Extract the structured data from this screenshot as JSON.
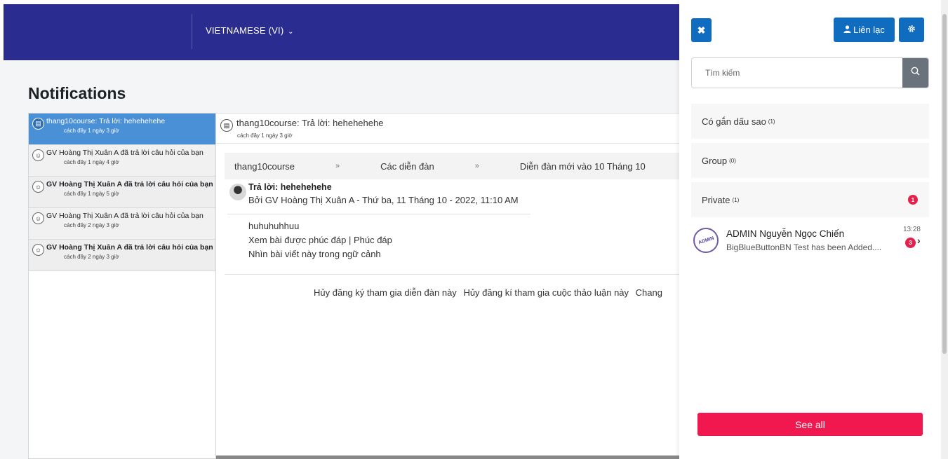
{
  "navbar": {
    "language": "VIETNAMESE (VI)",
    "language_chevron": "⌄"
  },
  "page": {
    "title": "Notifications"
  },
  "notifications": [
    {
      "title": "thang10course: Trả lời: hehehehehe",
      "time": "cách đây 1 ngày 3 giờ",
      "icon": "forum-icon",
      "state": "selected"
    },
    {
      "title": "GV Hoàng Thị Xuân A đã trả lời câu hỏi của bạn",
      "time": "cách đây 1 ngày 4 giờ",
      "icon": "user-icon",
      "state": "read"
    },
    {
      "title": "GV Hoàng Thị Xuân A đã trả lời câu hỏi của bạn",
      "time": "cách đây 1 ngày 5 giờ",
      "icon": "user-icon",
      "state": "unread"
    },
    {
      "title": "GV Hoàng Thị Xuân A đã trả lời câu hỏi của bạn",
      "time": "cách đây 2 ngày 3 giờ",
      "icon": "user-icon",
      "state": "read"
    },
    {
      "title": "GV Hoàng Thị Xuân A đã trả lời câu hỏi của bạn",
      "time": "cách đây 2 ngày 3 giờ",
      "icon": "user-icon",
      "state": "unread"
    }
  ],
  "detail": {
    "title": "thang10course: Trả lời: hehehehehe",
    "time": "cách đây 1 ngày 3 giờ",
    "breadcrumb": [
      "thang10course",
      "Các diễn đàn",
      "Diễn đàn mới vào 10 Tháng 10"
    ],
    "breadcrumb_sep": "»",
    "post_title": "Trả lời: hehehehehe",
    "post_by": "Bởi GV Hoàng Thị Xuân A - Thứ ba, 11 Tháng 10 - 2022, 11:10 AM",
    "post_body": "huhuhuhhuu",
    "post_links_1": "Xem bài được phúc đáp | Phúc đáp",
    "post_links_2": "Nhìn bài viết này trong ngữ cảnh",
    "footer_links": [
      "Hủy đăng ký tham gia diễn đàn này",
      "Hủy đăng kí tham gia cuộc thảo luận này",
      "Chang"
    ]
  },
  "drawer": {
    "close_label": "✖",
    "contact_label": "Liên lạc",
    "search_placeholder": "Tìm kiếm",
    "sections": [
      {
        "label": "Có gắn dấu sao",
        "count": "(1)",
        "badge": ""
      },
      {
        "label": "Group",
        "count": "(0)",
        "badge": ""
      },
      {
        "label": "Private",
        "count": "(1)",
        "badge": "1"
      }
    ],
    "conversation": {
      "name": "ADMIN Nguyễn Ngọc Chiến",
      "message": "BigBlueButtonBN Test has been Added....",
      "time": "13:28",
      "unread": "3",
      "avatar_text": "ADMIN"
    },
    "see_all_label": "See all"
  },
  "colors": {
    "navbar": "#2b2c8f",
    "primary": "#0f6cbf",
    "selected_row": "#4a90d6",
    "danger": "#f0184f"
  }
}
